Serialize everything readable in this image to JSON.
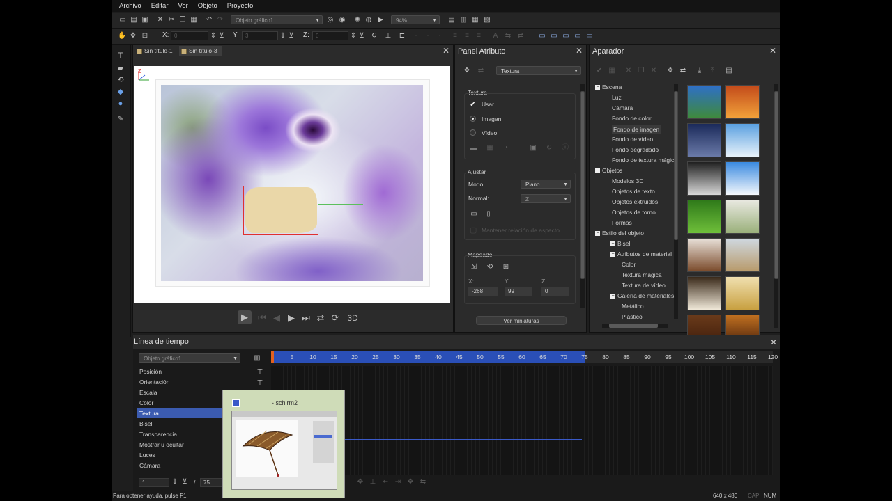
{
  "menu": [
    "Archivo",
    "Editar",
    "Ver",
    "Objeto",
    "Proyecto"
  ],
  "toolbar": {
    "object_combo": "Objeto gráfico1",
    "zoom_combo": "94%",
    "x_label": "X:",
    "y_label": "Y:",
    "z_label": "Z:",
    "x_value": "0",
    "y_value": "3",
    "z_value": "0"
  },
  "document_tabs": [
    "Sin título-1",
    "Sin título-3"
  ],
  "canvas": {
    "axis_label": "Z"
  },
  "playback": {
    "mode_3d": "3D"
  },
  "attribute_panel": {
    "title": "Panel Atributo",
    "combo": "Textura",
    "texture_section": "Textura",
    "use_label": "Usar",
    "image_label": "Imagen",
    "video_label": "Vídeo",
    "adjust_section": "Ajustar",
    "mode_label": "Modo:",
    "mode_value": "Plano",
    "normal_label": "Normal:",
    "normal_value": "Z",
    "keep_ratio": "Mantener relación de aspecto",
    "mapping_section": "Mapeado",
    "map_x_label": "X:",
    "map_y_label": "Y:",
    "map_z_label": "Z:",
    "map_x_value": "-268",
    "map_y_value": "99",
    "map_z_value": "0",
    "view_thumbs_button": "Ver miniaturas"
  },
  "library_panel": {
    "title": "Aparador",
    "tree": [
      {
        "label": "Escena",
        "level": 0,
        "expander": "−"
      },
      {
        "label": "Luz",
        "level": 1
      },
      {
        "label": "Cámara",
        "level": 1
      },
      {
        "label": "Fondo de color",
        "level": 1
      },
      {
        "label": "Fondo de imagen",
        "level": 1,
        "selected": true
      },
      {
        "label": "Fondo de vídeo",
        "level": 1
      },
      {
        "label": "Fondo degradado",
        "level": 1
      },
      {
        "label": "Fondo de textura mágic",
        "level": 1
      },
      {
        "label": "Objetos",
        "level": 0,
        "expander": "−"
      },
      {
        "label": "Modelos 3D",
        "level": 1
      },
      {
        "label": "Objetos de texto",
        "level": 1
      },
      {
        "label": "Objetos extruidos",
        "level": 1
      },
      {
        "label": "Objetos de torno",
        "level": 1
      },
      {
        "label": "Formas",
        "level": 1
      },
      {
        "label": "Estilo del objeto",
        "level": 0,
        "expander": "−"
      },
      {
        "label": "Bisel",
        "level": 1,
        "expander": "+"
      },
      {
        "label": "Atributos de material",
        "level": 1,
        "expander": "−"
      },
      {
        "label": "Color",
        "level": 2
      },
      {
        "label": "Textura mágica",
        "level": 2
      },
      {
        "label": "Textura de vídeo",
        "level": 2
      },
      {
        "label": "Galería de materiales",
        "level": 1,
        "expander": "−"
      },
      {
        "label": "Metálico",
        "level": 2
      },
      {
        "label": "Plástico",
        "level": 2
      }
    ],
    "thumbnails": [
      {
        "top": "#2e6fc8",
        "bottom": "#3f8a3a"
      },
      {
        "top": "#c24a1a",
        "bottom": "#f2a23a"
      },
      {
        "top": "#1b2a5a",
        "bottom": "#6a7aa8"
      },
      {
        "top": "#5aa0e0",
        "bottom": "#e8f2fa"
      },
      {
        "top": "#202020",
        "bottom": "#d8d8d8"
      },
      {
        "top": "#3a8ae0",
        "bottom": "#f4f8fc"
      },
      {
        "top": "#2f7a1a",
        "bottom": "#6fbf3a"
      },
      {
        "top": "#e8e8e0",
        "bottom": "#9ab07a"
      },
      {
        "top": "#e8e0d8",
        "bottom": "#7a4a2a"
      },
      {
        "top": "#cfd8e0",
        "bottom": "#b89a6a"
      },
      {
        "top": "#3a2a1a",
        "bottom": "#f0e8d8"
      },
      {
        "top": "#f0e0b0",
        "bottom": "#c8a040"
      },
      {
        "top": "#6a3a1a",
        "bottom": "#3a1a0a"
      },
      {
        "top": "#c07020",
        "bottom": "#401a0a"
      }
    ]
  },
  "timeline": {
    "title": "Línea de tiempo",
    "object_combo": "Objeto gráfico1",
    "tracks": [
      "Posición",
      "Orientación",
      "Escala",
      "Color",
      "Textura",
      "Bisel",
      "Transparencia",
      "Mostrar u ocultar",
      "Luces",
      "Cámara"
    ],
    "selected_track": "Textura",
    "ruler_ticks": [
      "5",
      "10",
      "15",
      "20",
      "25",
      "30",
      "35",
      "40",
      "45",
      "50",
      "55",
      "60",
      "65",
      "70",
      "75",
      "80",
      "85",
      "90",
      "95",
      "100",
      "105",
      "110",
      "115",
      "120"
    ],
    "ruler_max": 120,
    "active_end_frame": 75,
    "current_frame": "1",
    "total_frames": "75",
    "frame_separator": "/"
  },
  "popup": {
    "title": "- schirm2"
  },
  "status": {
    "help": "Para obtener ayuda, pulse F1",
    "size": "640 x 480",
    "caps": "CAP",
    "num": "NUM"
  }
}
